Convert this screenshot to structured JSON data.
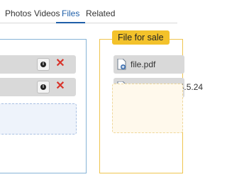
{
  "tabs": [
    {
      "label": "Photos",
      "active": false
    },
    {
      "label": "Videos",
      "active": false
    },
    {
      "label": "Files",
      "active": true
    },
    {
      "label": "Related",
      "active": false
    }
  ],
  "left_panel": {
    "rows": [
      {
        "info_icon": "info-icon",
        "remove_icon": "close-icon"
      },
      {
        "info_icon": "info-icon",
        "remove_icon": "close-icon"
      }
    ]
  },
  "right_panel": {
    "badge": "File for sale",
    "files": [
      {
        "name": "file.pdf",
        "icon": "file-add-icon"
      },
      {
        "name": "yootheme_j_4.5.24",
        "icon": "file-add-icon"
      }
    ]
  },
  "colors": {
    "accent": "#1f5fa8",
    "badge": "#f3c22b",
    "left_border": "#86b3d6",
    "right_border": "#efc44e",
    "remove": "#d9342b",
    "row_bg": "#d9d9d9"
  },
  "glyphs": {
    "info": "i",
    "remove": "✕"
  }
}
